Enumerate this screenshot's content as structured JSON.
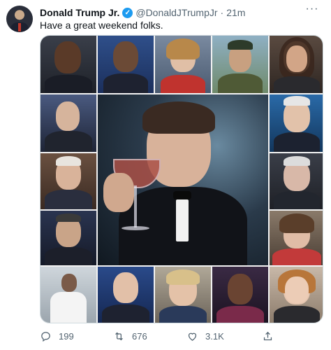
{
  "tweet": {
    "author_name": "Donald Trump Jr.",
    "handle": "@DonaldJTrumpJr",
    "separator": "·",
    "time": "21m",
    "text": "Have a great weekend folks.",
    "more_label": "···"
  },
  "actions": {
    "replies": "199",
    "retweets": "676",
    "likes": "3.1K"
  },
  "colors": {
    "verified": "#1d9bf0",
    "secondary_text": "#536471",
    "border": "#cfd9de"
  },
  "icons": [
    "verified-badge-icon",
    "more-icon",
    "reply-icon",
    "retweet-icon",
    "like-icon",
    "share-icon"
  ]
}
